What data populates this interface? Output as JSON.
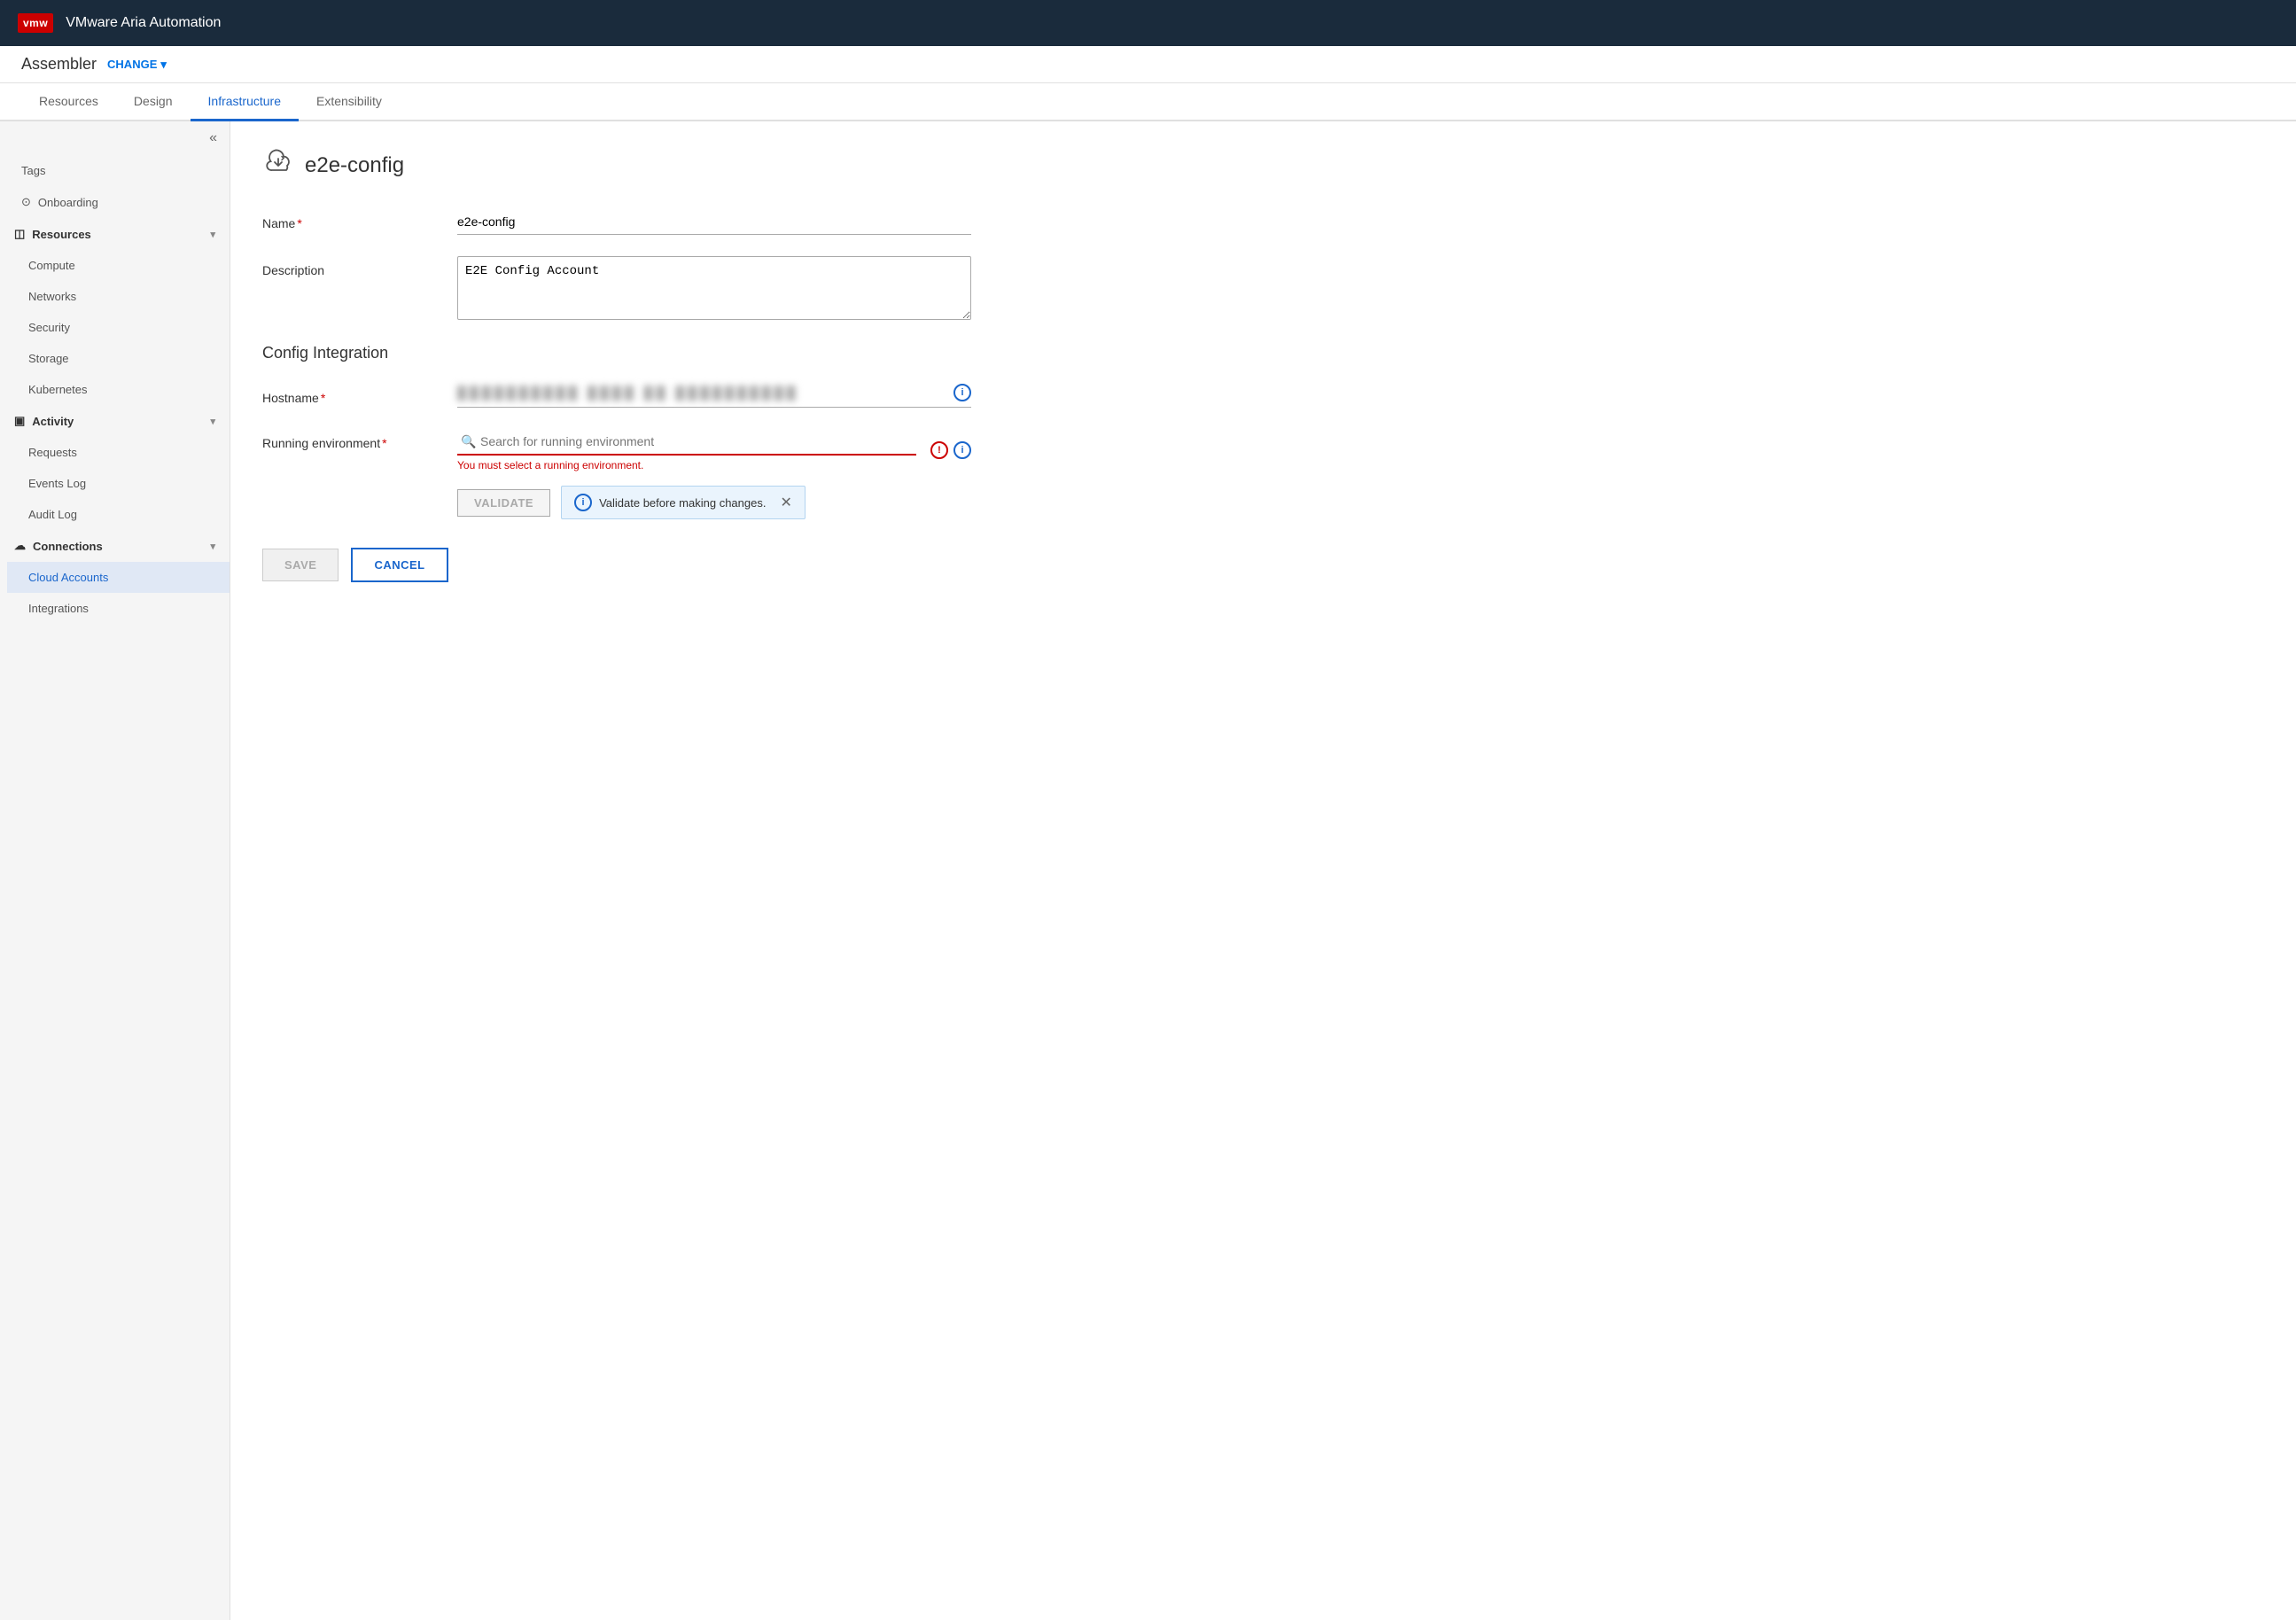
{
  "topbar": {
    "logo": "vmw",
    "title": "VMware Aria Automation"
  },
  "projectbar": {
    "project_name": "Assembler",
    "change_label": "CHANGE"
  },
  "tabs": [
    {
      "id": "resources",
      "label": "Resources"
    },
    {
      "id": "design",
      "label": "Design"
    },
    {
      "id": "infrastructure",
      "label": "Infrastructure"
    },
    {
      "id": "extensibility",
      "label": "Extensibility"
    }
  ],
  "sidebar": {
    "collapse_icon": "«",
    "items": [
      {
        "id": "tags",
        "label": "Tags",
        "icon": "",
        "section": false
      },
      {
        "id": "onboarding",
        "label": "Onboarding",
        "icon": "⊙",
        "section": false
      },
      {
        "id": "resources",
        "label": "Resources",
        "icon": "◫",
        "section": true,
        "chevron": "▾"
      },
      {
        "id": "compute",
        "label": "Compute",
        "indent": true
      },
      {
        "id": "networks",
        "label": "Networks",
        "indent": true
      },
      {
        "id": "security",
        "label": "Security",
        "indent": true
      },
      {
        "id": "storage",
        "label": "Storage",
        "indent": true
      },
      {
        "id": "kubernetes",
        "label": "Kubernetes",
        "indent": true
      },
      {
        "id": "activity",
        "label": "Activity",
        "icon": "▣",
        "section": true,
        "chevron": "▾"
      },
      {
        "id": "requests",
        "label": "Requests",
        "indent": true
      },
      {
        "id": "events-log",
        "label": "Events Log",
        "indent": true
      },
      {
        "id": "audit-log",
        "label": "Audit Log",
        "indent": true
      },
      {
        "id": "connections",
        "label": "Connections",
        "icon": "☁",
        "section": true,
        "chevron": "▾"
      },
      {
        "id": "cloud-accounts",
        "label": "Cloud Accounts",
        "indent": true,
        "selected": true
      },
      {
        "id": "integrations",
        "label": "Integrations",
        "indent": true
      }
    ]
  },
  "page": {
    "icon": "↻",
    "title": "e2e-config",
    "form": {
      "name_label": "Name",
      "name_value": "e2e-config",
      "description_label": "Description",
      "description_value": "E2E Config Account",
      "section_title": "Config Integration",
      "hostname_label": "Hostname",
      "hostname_placeholder": "██████████ ██ ██████",
      "running_env_label": "Running environment",
      "running_env_placeholder": "Search for running environment",
      "error_text": "You must select a running environment.",
      "validate_label": "VALIDATE",
      "validate_message": "Validate before making changes.",
      "save_label": "SAVE",
      "cancel_label": "CANCEL"
    }
  }
}
